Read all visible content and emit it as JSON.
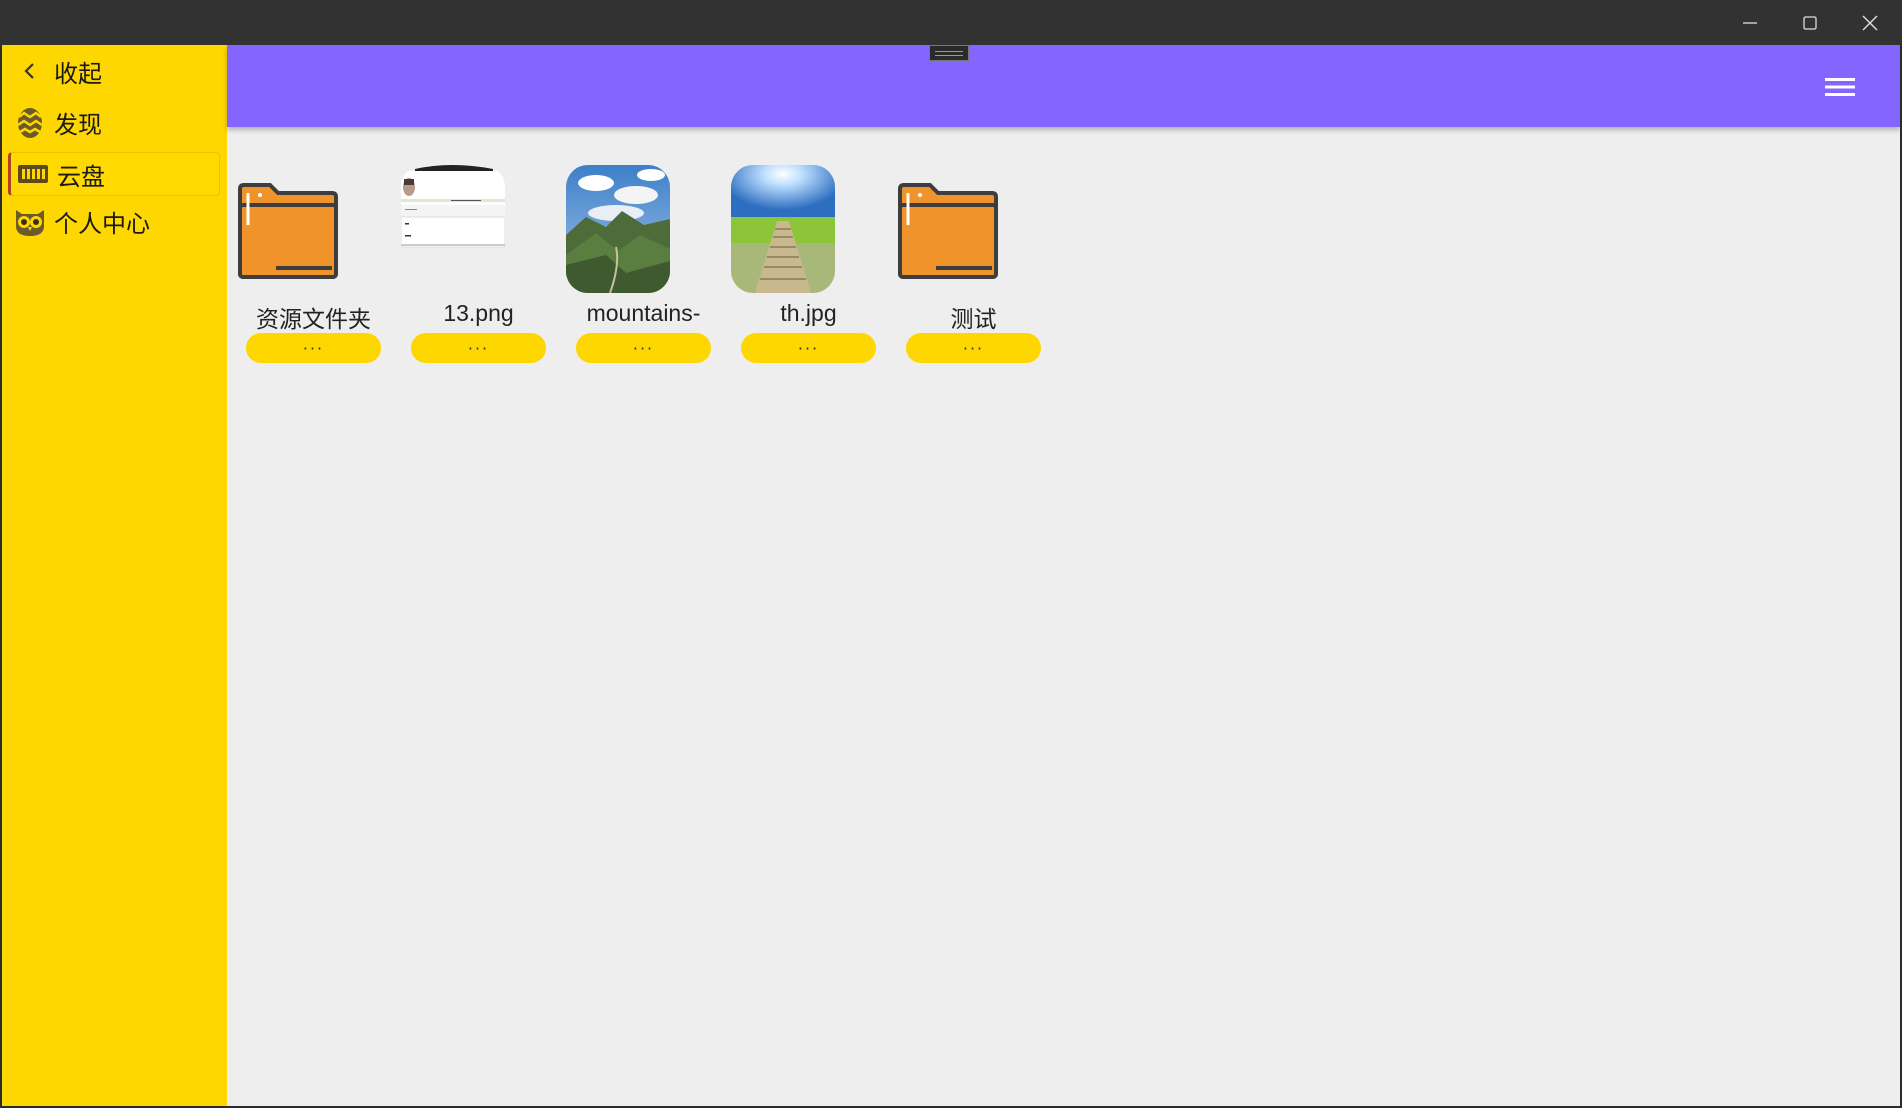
{
  "window": {
    "controls": [
      "minimize-icon",
      "maximize-icon",
      "close-icon"
    ]
  },
  "sidebar": {
    "items": [
      {
        "label": "收起",
        "icon": "chevron-left-icon"
      },
      {
        "label": "发现",
        "icon": "easter-egg-icon"
      },
      {
        "label": "云盘",
        "icon": "storage-icon",
        "active": true
      },
      {
        "label": "个人中心",
        "icon": "owl-icon"
      }
    ]
  },
  "header": {
    "menu_icon": "hamburger-menu-icon",
    "color": "#8466ff"
  },
  "files": [
    {
      "name": "资源文件夹",
      "type": "folder",
      "more": "···"
    },
    {
      "name": "13.png",
      "type": "image-screenshot",
      "more": "···"
    },
    {
      "name": "mountains-",
      "type": "image-mountains",
      "more": "···"
    },
    {
      "name": "th.jpg",
      "type": "image-bridge",
      "more": "···"
    },
    {
      "name": "测试",
      "type": "folder",
      "more": "···"
    }
  ],
  "colors": {
    "sidebar": "#ffd700",
    "header": "#8466ff",
    "content_bg": "#eeeeee",
    "folder": "#f0932b"
  }
}
